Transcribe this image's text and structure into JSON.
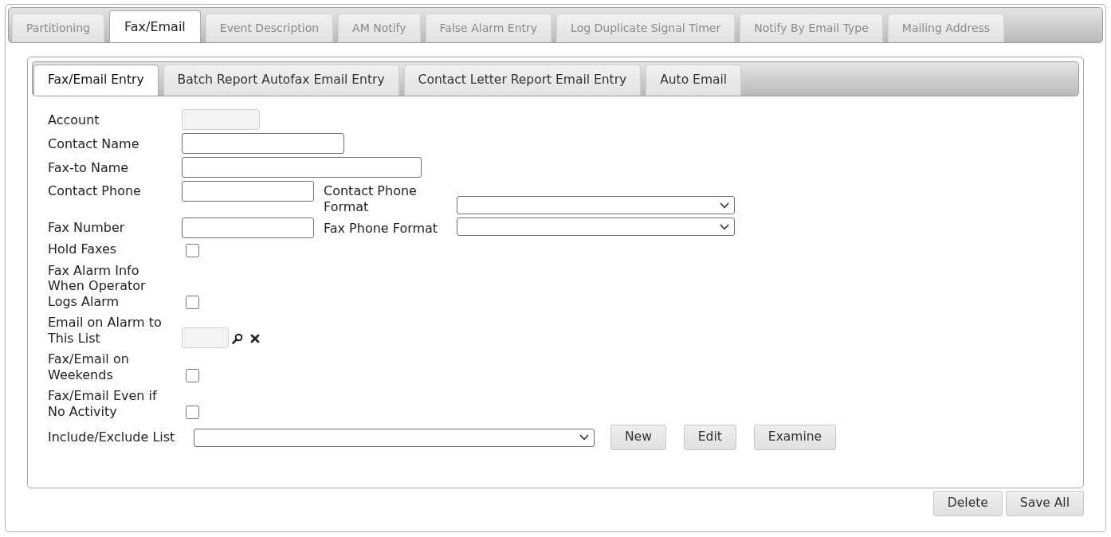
{
  "outer_tabs": [
    {
      "label": "Partitioning",
      "selected": false
    },
    {
      "label": "Fax/Email",
      "selected": true
    },
    {
      "label": "Event Description",
      "selected": false
    },
    {
      "label": "AM Notify",
      "selected": false
    },
    {
      "label": "False Alarm Entry",
      "selected": false
    },
    {
      "label": "Log Duplicate Signal Timer",
      "selected": false
    },
    {
      "label": "Notify By Email Type",
      "selected": false
    },
    {
      "label": "Mailing Address",
      "selected": false
    }
  ],
  "inner_tabs": [
    {
      "label": "Fax/Email Entry",
      "selected": true
    },
    {
      "label": "Batch Report Autofax Email Entry",
      "selected": false
    },
    {
      "label": "Contact Letter Report Email Entry",
      "selected": false
    },
    {
      "label": "Auto Email",
      "selected": false
    }
  ],
  "form": [
    {
      "kind": "text",
      "label": "Account",
      "disabled": true
    },
    {
      "kind": "text",
      "label": "Contact Name",
      "disabled": false
    },
    {
      "kind": "text",
      "label": "Fax-to Name",
      "disabled": false
    },
    {
      "kind": "phone",
      "label": "Contact Phone",
      "disabled": false,
      "format_label": "Contact Phone Format"
    },
    {
      "kind": "phone",
      "label": "Fax Number",
      "disabled": false,
      "format_label": "Fax Phone Format"
    },
    {
      "kind": "checkbox",
      "label": "Hold Faxes",
      "checked": false
    },
    {
      "kind": "checkbox",
      "label": "Fax Alarm Info When Operator Logs Alarm",
      "checked": false
    },
    {
      "kind": "lookup",
      "label": "Email on Alarm to This List",
      "disabled": true
    },
    {
      "kind": "checkbox",
      "label": "Fax/Email on Weekends",
      "checked": false
    },
    {
      "kind": "checkbox",
      "label": "Fax/Email Even if No Activity",
      "checked": false
    },
    {
      "kind": "list",
      "label": "Include/Exclude List",
      "buttons": [
        "New",
        "Edit",
        "Examine"
      ]
    }
  ],
  "actions": [
    "Delete",
    "Save All"
  ]
}
